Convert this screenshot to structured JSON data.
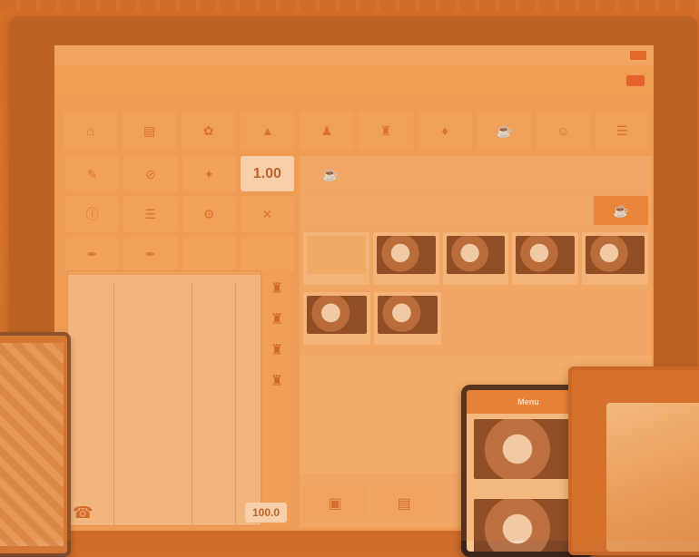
{
  "qty_display": "1.00",
  "total_display": "100.0",
  "mobile_header": "Menu",
  "toolbar": [
    "⌂",
    "▤",
    "✿",
    "▲",
    "♟",
    "♜",
    "♦",
    "☕",
    "☺",
    "☰"
  ],
  "left_buttons": [
    {
      "icon": "✎"
    },
    {
      "icon": "⊘"
    },
    {
      "icon": "✦"
    },
    {
      "icon": ""
    },
    {
      "icon": "ⓘ"
    },
    {
      "icon": "☰"
    },
    {
      "icon": "⚙"
    },
    {
      "icon": "✕"
    },
    {
      "icon": "✒"
    },
    {
      "icon": "✒"
    },
    {
      "icon": ""
    },
    {
      "icon": ""
    }
  ],
  "order": {
    "rows": [
      [
        "",
        ""
      ],
      [
        "",
        ""
      ],
      [
        "",
        ""
      ]
    ]
  },
  "categories_row1": [
    "",
    "",
    "",
    "",
    "",
    ""
  ],
  "categories_row2": [
    "",
    "",
    "",
    "",
    "",
    ""
  ],
  "foods_row1": [
    "",
    "",
    "",
    "",
    ""
  ],
  "foods_row2": [
    "",
    ""
  ]
}
